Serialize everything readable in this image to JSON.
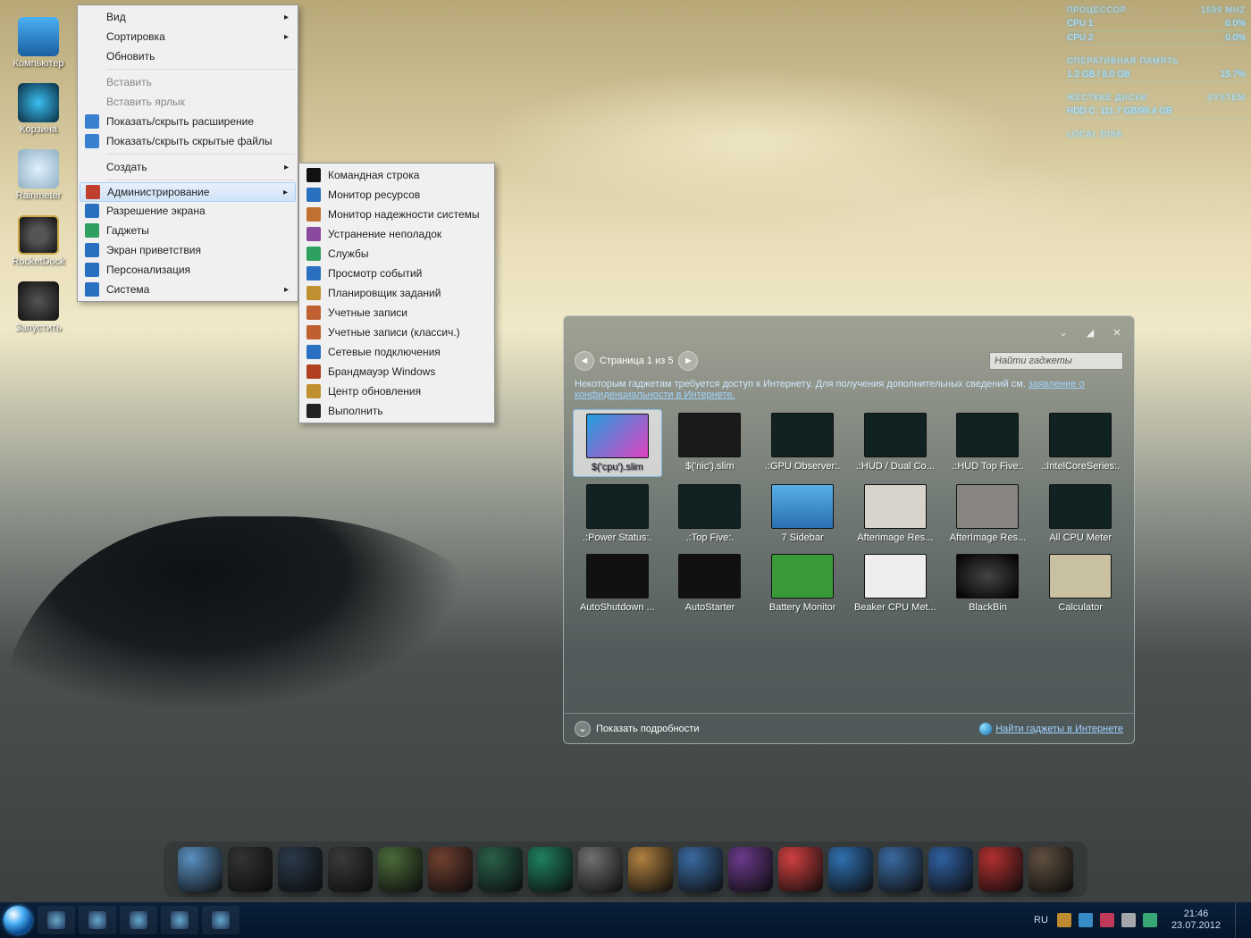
{
  "desktop_icons": [
    {
      "label": "Компьютер",
      "cls": "ic-computer"
    },
    {
      "label": "Корзина",
      "cls": "ic-bin"
    },
    {
      "label": "Rainmeter",
      "cls": "ic-rain"
    },
    {
      "label": "RocketDock",
      "cls": "ic-rocket"
    },
    {
      "label": "Запустить",
      "cls": "ic-gear"
    }
  ],
  "context_menu1": {
    "items": [
      {
        "label": "Вид",
        "arrow": true
      },
      {
        "label": "Сортировка",
        "arrow": true
      },
      {
        "label": "Обновить"
      },
      {
        "sep": true
      },
      {
        "label": "Вставить",
        "disabled": true
      },
      {
        "label": "Вставить ярлык",
        "disabled": true
      },
      {
        "label": "Показать/скрыть расширение",
        "icon": "#3a80d0"
      },
      {
        "label": "Показать/скрыть скрытые файлы",
        "icon": "#3a80d0"
      },
      {
        "sep": true
      },
      {
        "label": "Создать",
        "arrow": true
      },
      {
        "sep": true
      },
      {
        "label": "Администрирование",
        "arrow": true,
        "hl": true,
        "icon": "#c04030"
      },
      {
        "label": "Разрешение экрана",
        "icon": "#2a70c0"
      },
      {
        "label": "Гаджеты",
        "icon": "#30a060"
      },
      {
        "label": "Экран приветствия",
        "icon": "#2a70c0"
      },
      {
        "label": "Персонализация",
        "icon": "#2a70c0"
      },
      {
        "label": "Система",
        "arrow": true,
        "icon": "#2a70c0"
      }
    ]
  },
  "context_menu2": {
    "items": [
      {
        "label": "Командная строка",
        "icon": "#111"
      },
      {
        "label": "Монитор ресурсов",
        "icon": "#2a70c0"
      },
      {
        "label": "Монитор надежности системы",
        "icon": "#c07030"
      },
      {
        "label": "Устранение неполадок",
        "icon": "#8a4aa0"
      },
      {
        "label": "Службы",
        "icon": "#30a060"
      },
      {
        "label": "Просмотр событий",
        "icon": "#2a70c0"
      },
      {
        "label": "Планировщик заданий",
        "icon": "#c09030"
      },
      {
        "label": "Учетные записи",
        "icon": "#c06030"
      },
      {
        "label": "Учетные записи (классич.)",
        "icon": "#c06030"
      },
      {
        "label": "Сетевые подключения",
        "icon": "#2a70c0"
      },
      {
        "label": "Брандмауэр Windows",
        "icon": "#b04020"
      },
      {
        "label": "Центр обновления",
        "icon": "#c09030"
      },
      {
        "label": "Выполнить",
        "icon": "#222"
      }
    ]
  },
  "rainmeter": {
    "cpu": {
      "title": "ПРОЦЕССОР",
      "freq": "1599 MHZ",
      "cpu1": "CPU 1",
      "cpu1v": "0.0%",
      "cpu2": "CPU 2",
      "cpu2v": "0.0%"
    },
    "ram": {
      "title": "ОПЕРАТИВНАЯ ПАМЯТЬ",
      "used": "1.2 GB / 8.0 GB",
      "pct": "15.7%"
    },
    "hdd": {
      "title": "ЖЕСТКИЕ ДИСКИ",
      "sys": "SYSTEM",
      "line": "HDD C: 111.7 GB/99.4 GB"
    },
    "local": {
      "title": "LOCAL DISK"
    }
  },
  "gadgets": {
    "page_label": "Страница 1 из 5",
    "search_placeholder": "Найти гаджеты",
    "notice_text": "Некоторым гаджетам требуется доступ к Интернету. Для получения дополнительных сведений см. ",
    "notice_link": "заявление о конфиденциальности в Интернете.",
    "show_details": "Показать подробности",
    "find_online": "Найти гаджеты в Интернете",
    "items": [
      {
        "label": "$('cpu').slim",
        "sel": true,
        "bg": "linear-gradient(135deg,#20a0e0,#e040c0)"
      },
      {
        "label": "$('nic').slim",
        "bg": "#1a1a1a"
      },
      {
        "label": ".:GPU Observer:.",
        "bg": "#122"
      },
      {
        "label": ".:HUD / Dual Co...",
        "bg": "#122"
      },
      {
        "label": ".:HUD Top Five:.",
        "bg": "#122"
      },
      {
        "label": ".:IntelCoreSeries:.",
        "bg": "#122"
      },
      {
        "label": ".:Power Status:.",
        "bg": "#122"
      },
      {
        "label": ".:Top Five:.",
        "bg": "#122"
      },
      {
        "label": "7 Sidebar",
        "bg": "linear-gradient(#5ab0e5,#2a70b0)"
      },
      {
        "label": "Afterimage Res...",
        "bg": "#d8d4cc"
      },
      {
        "label": "AfterImage Res...",
        "bg": "#888480"
      },
      {
        "label": "All CPU Meter",
        "bg": "#122"
      },
      {
        "label": "AutoShutdown ...",
        "bg": "#111"
      },
      {
        "label": "AutoStarter",
        "bg": "#111"
      },
      {
        "label": "Battery Monitor",
        "bg": "#3a9a3a"
      },
      {
        "label": "Beaker CPU Met...",
        "bg": "#eee"
      },
      {
        "label": "BlackBin",
        "bg": "radial-gradient(#444,#000)"
      },
      {
        "label": "Calculator",
        "bg": "#c8c0a0"
      }
    ]
  },
  "dock": {
    "count": 18
  },
  "taskbar": {
    "lang": "RU",
    "time": "21:46",
    "date": "23.07.2012",
    "pinned": 5,
    "tray": 5
  }
}
